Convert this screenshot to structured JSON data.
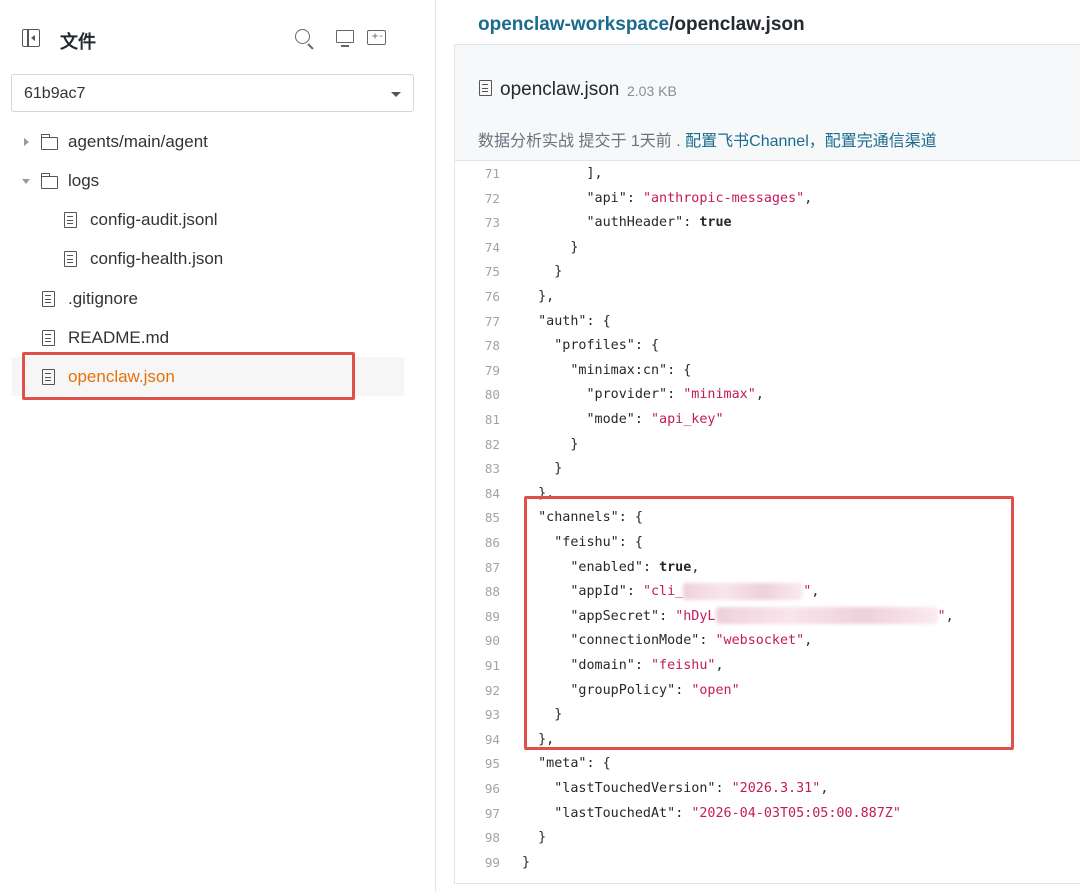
{
  "sidebar": {
    "title": "文件",
    "branch": "61b9ac7",
    "tree": [
      {
        "type": "folder",
        "label": "agents/main/agent",
        "expanded": false,
        "depth": 0
      },
      {
        "type": "folder",
        "label": "logs",
        "expanded": true,
        "depth": 0
      },
      {
        "type": "file",
        "label": "config-audit.jsonl",
        "depth": 1
      },
      {
        "type": "file",
        "label": "config-health.json",
        "depth": 1
      },
      {
        "type": "file",
        "label": ".gitignore",
        "depth": 0
      },
      {
        "type": "file",
        "label": "README.md",
        "depth": 0
      },
      {
        "type": "file",
        "label": "openclaw.json",
        "depth": 0,
        "selected": true
      }
    ],
    "icons": [
      "sidebar-toggle-icon",
      "search-icon",
      "monitor-icon",
      "compose-icon"
    ]
  },
  "breadcrumb": {
    "repo": "openclaw-workspace",
    "separator": "/",
    "file": "openclaw.json"
  },
  "file": {
    "name": "openclaw.json",
    "size": "2.03 KB",
    "commit_author": "数据分析实战 提交于 1天前",
    "commit_dot": ".",
    "commit_message": "配置飞书Channel，配置完通信渠道"
  },
  "code": [
    {
      "n": "71",
      "t": [
        [
          "p",
          "        ],"
        ]
      ]
    },
    {
      "n": "72",
      "t": [
        [
          "p",
          "        "
        ],
        [
          "k",
          "\"api\""
        ],
        [
          "p",
          ": "
        ],
        [
          "s",
          "\"anthropic-messages\""
        ],
        [
          "p",
          ","
        ]
      ]
    },
    {
      "n": "73",
      "t": [
        [
          "p",
          "        "
        ],
        [
          "k",
          "\"authHeader\""
        ],
        [
          "p",
          ": "
        ],
        [
          "b",
          "true"
        ]
      ]
    },
    {
      "n": "74",
      "t": [
        [
          "p",
          "      }"
        ]
      ]
    },
    {
      "n": "75",
      "t": [
        [
          "p",
          "    }"
        ]
      ]
    },
    {
      "n": "76",
      "t": [
        [
          "p",
          "  },"
        ]
      ]
    },
    {
      "n": "77",
      "t": [
        [
          "p",
          "  "
        ],
        [
          "k",
          "\"auth\""
        ],
        [
          "p",
          ": {"
        ]
      ]
    },
    {
      "n": "78",
      "t": [
        [
          "p",
          "    "
        ],
        [
          "k",
          "\"profiles\""
        ],
        [
          "p",
          ": {"
        ]
      ]
    },
    {
      "n": "79",
      "t": [
        [
          "p",
          "      "
        ],
        [
          "k",
          "\"minimax:cn\""
        ],
        [
          "p",
          ": {"
        ]
      ]
    },
    {
      "n": "80",
      "t": [
        [
          "p",
          "        "
        ],
        [
          "k",
          "\"provider\""
        ],
        [
          "p",
          ": "
        ],
        [
          "s",
          "\"minimax\""
        ],
        [
          "p",
          ","
        ]
      ]
    },
    {
      "n": "81",
      "t": [
        [
          "p",
          "        "
        ],
        [
          "k",
          "\"mode\""
        ],
        [
          "p",
          ": "
        ],
        [
          "s",
          "\"api_key\""
        ]
      ]
    },
    {
      "n": "82",
      "t": [
        [
          "p",
          "      }"
        ]
      ]
    },
    {
      "n": "83",
      "t": [
        [
          "p",
          "    }"
        ]
      ]
    },
    {
      "n": "84",
      "t": [
        [
          "p",
          "  },"
        ]
      ]
    },
    {
      "n": "85",
      "t": [
        [
          "p",
          "  "
        ],
        [
          "k",
          "\"channels\""
        ],
        [
          "p",
          ": {"
        ]
      ]
    },
    {
      "n": "86",
      "t": [
        [
          "p",
          "    "
        ],
        [
          "k",
          "\"feishu\""
        ],
        [
          "p",
          ": {"
        ]
      ]
    },
    {
      "n": "87",
      "t": [
        [
          "p",
          "      "
        ],
        [
          "k",
          "\"enabled\""
        ],
        [
          "p",
          ": "
        ],
        [
          "b",
          "true"
        ],
        [
          "p",
          ","
        ]
      ]
    },
    {
      "n": "88",
      "t": [
        [
          "p",
          "      "
        ],
        [
          "k",
          "\"appId\""
        ],
        [
          "p",
          ": "
        ],
        [
          "s",
          "\"cli_"
        ],
        [
          "x",
          "120"
        ],
        [
          "s",
          "\""
        ],
        [
          "p",
          ","
        ]
      ]
    },
    {
      "n": "89",
      "t": [
        [
          "p",
          "      "
        ],
        [
          "k",
          "\"appSecret\""
        ],
        [
          "p",
          ": "
        ],
        [
          "s",
          "\"hDyL"
        ],
        [
          "x",
          "222"
        ],
        [
          "s",
          "\""
        ],
        [
          "p",
          ","
        ]
      ]
    },
    {
      "n": "90",
      "t": [
        [
          "p",
          "      "
        ],
        [
          "k",
          "\"connectionMode\""
        ],
        [
          "p",
          ": "
        ],
        [
          "s",
          "\"websocket\""
        ],
        [
          "p",
          ","
        ]
      ]
    },
    {
      "n": "91",
      "t": [
        [
          "p",
          "      "
        ],
        [
          "k",
          "\"domain\""
        ],
        [
          "p",
          ": "
        ],
        [
          "s",
          "\"feishu\""
        ],
        [
          "p",
          ","
        ]
      ]
    },
    {
      "n": "92",
      "t": [
        [
          "p",
          "      "
        ],
        [
          "k",
          "\"groupPolicy\""
        ],
        [
          "p",
          ": "
        ],
        [
          "s",
          "\"open\""
        ]
      ]
    },
    {
      "n": "93",
      "t": [
        [
          "p",
          "    }"
        ]
      ]
    },
    {
      "n": "94",
      "t": [
        [
          "p",
          "  },"
        ]
      ]
    },
    {
      "n": "95",
      "t": [
        [
          "p",
          "  "
        ],
        [
          "k",
          "\"meta\""
        ],
        [
          "p",
          ": {"
        ]
      ]
    },
    {
      "n": "96",
      "t": [
        [
          "p",
          "    "
        ],
        [
          "k",
          "\"lastTouchedVersion\""
        ],
        [
          "p",
          ": "
        ],
        [
          "s",
          "\"2026.3.31\""
        ],
        [
          "p",
          ","
        ]
      ]
    },
    {
      "n": "97",
      "t": [
        [
          "p",
          "    "
        ],
        [
          "k",
          "\"lastTouchedAt\""
        ],
        [
          "p",
          ": "
        ],
        [
          "s",
          "\"2026-04-03T05:05:00.887Z\""
        ]
      ]
    },
    {
      "n": "98",
      "t": [
        [
          "p",
          "  }"
        ]
      ]
    },
    {
      "n": "99",
      "t": [
        [
          "p",
          "}"
        ]
      ]
    }
  ],
  "colors": {
    "accent_link": "#1a6c8f",
    "selected_file": "#e8710a",
    "string": "#c41a5d",
    "highlight_box": "#e0504b"
  }
}
